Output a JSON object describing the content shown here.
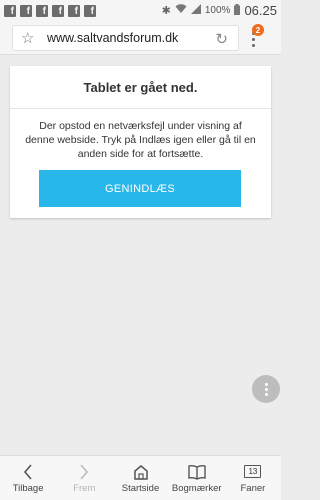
{
  "status_bar": {
    "notification_icons": [
      "facebook-icon",
      "facebook-icon",
      "facebook-icon",
      "facebook-icon",
      "facebook-icon",
      "facebook-icon"
    ],
    "battery": "100%",
    "time": "06.25"
  },
  "address_bar": {
    "url": "www.saltvandsforum.dk",
    "menu_badge": "2"
  },
  "error": {
    "title": "Tablet er gået ned.",
    "message": "Der opstod en netværksfejl under visning af denne webside. Tryk på Indlæs igen eller gå til en anden side for at fortsætte.",
    "button_label": "GENINDLÆS"
  },
  "bottom_nav": {
    "back": "Tilbage",
    "forward": "Frem",
    "home": "Startside",
    "bookmarks": "Bogmærker",
    "tabs": "Faner",
    "tab_count": "13"
  },
  "colors": {
    "accent": "#29b6e8",
    "badge": "#f06a1c"
  }
}
